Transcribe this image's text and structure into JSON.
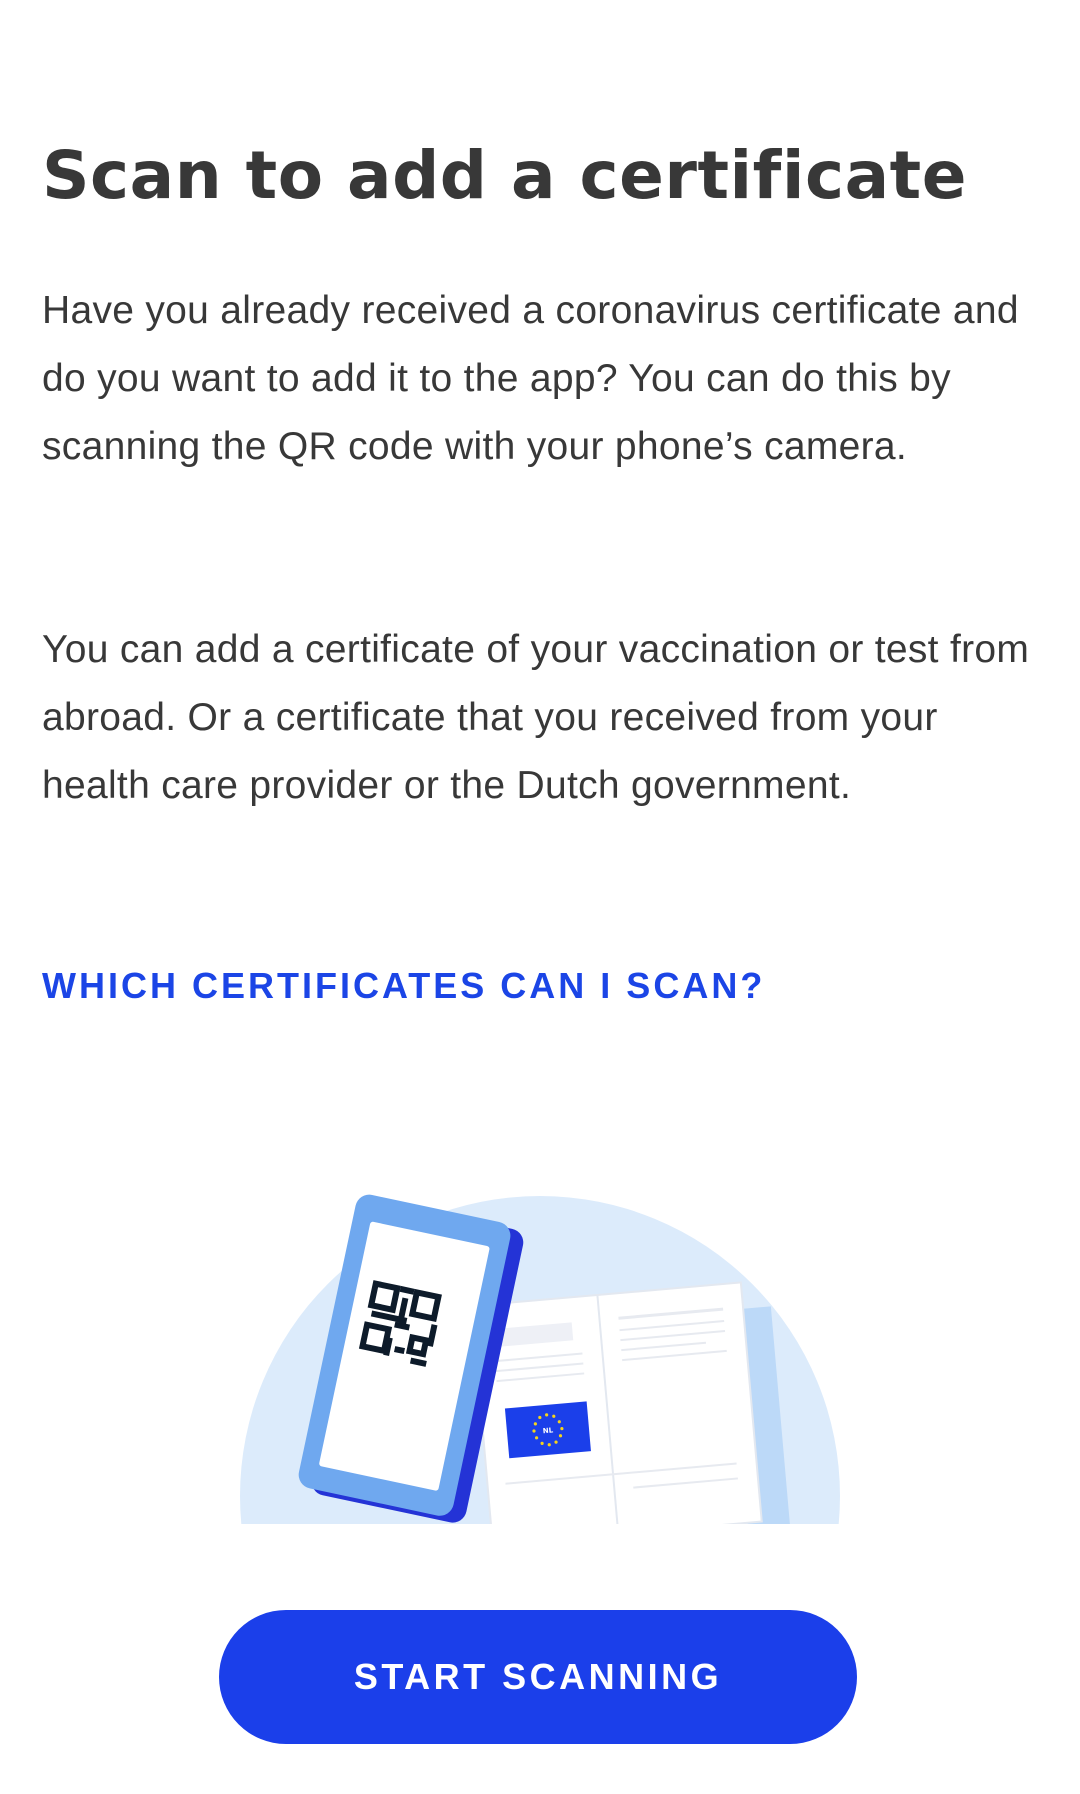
{
  "header": {
    "title": "Scan to add a certificate"
  },
  "content": {
    "paragraph_1": "Have you already received a coronavirus certificate and do you want to add it to the app? You can do this by scanning the QR code with your phone’s camera.",
    "paragraph_2": "You can add a certificate of your vaccination or test from abroad. Or a certificate that you received from your health care provider or the Dutch government.",
    "link_label": "WHICH CERTIFICATES CAN I SCAN?"
  },
  "illustration": {
    "flag_label": "NL",
    "icons": [
      "phone-icon",
      "qr-code-icon",
      "certificate-document-icon",
      "eu-flag-icon"
    ]
  },
  "footer": {
    "button_label": "START SCANNING"
  },
  "colors": {
    "accent": "#1b3fea",
    "link": "#1b45e6",
    "text": "#383838",
    "illustration_background": "#dcebfb",
    "phone": "#6fa8ef"
  }
}
